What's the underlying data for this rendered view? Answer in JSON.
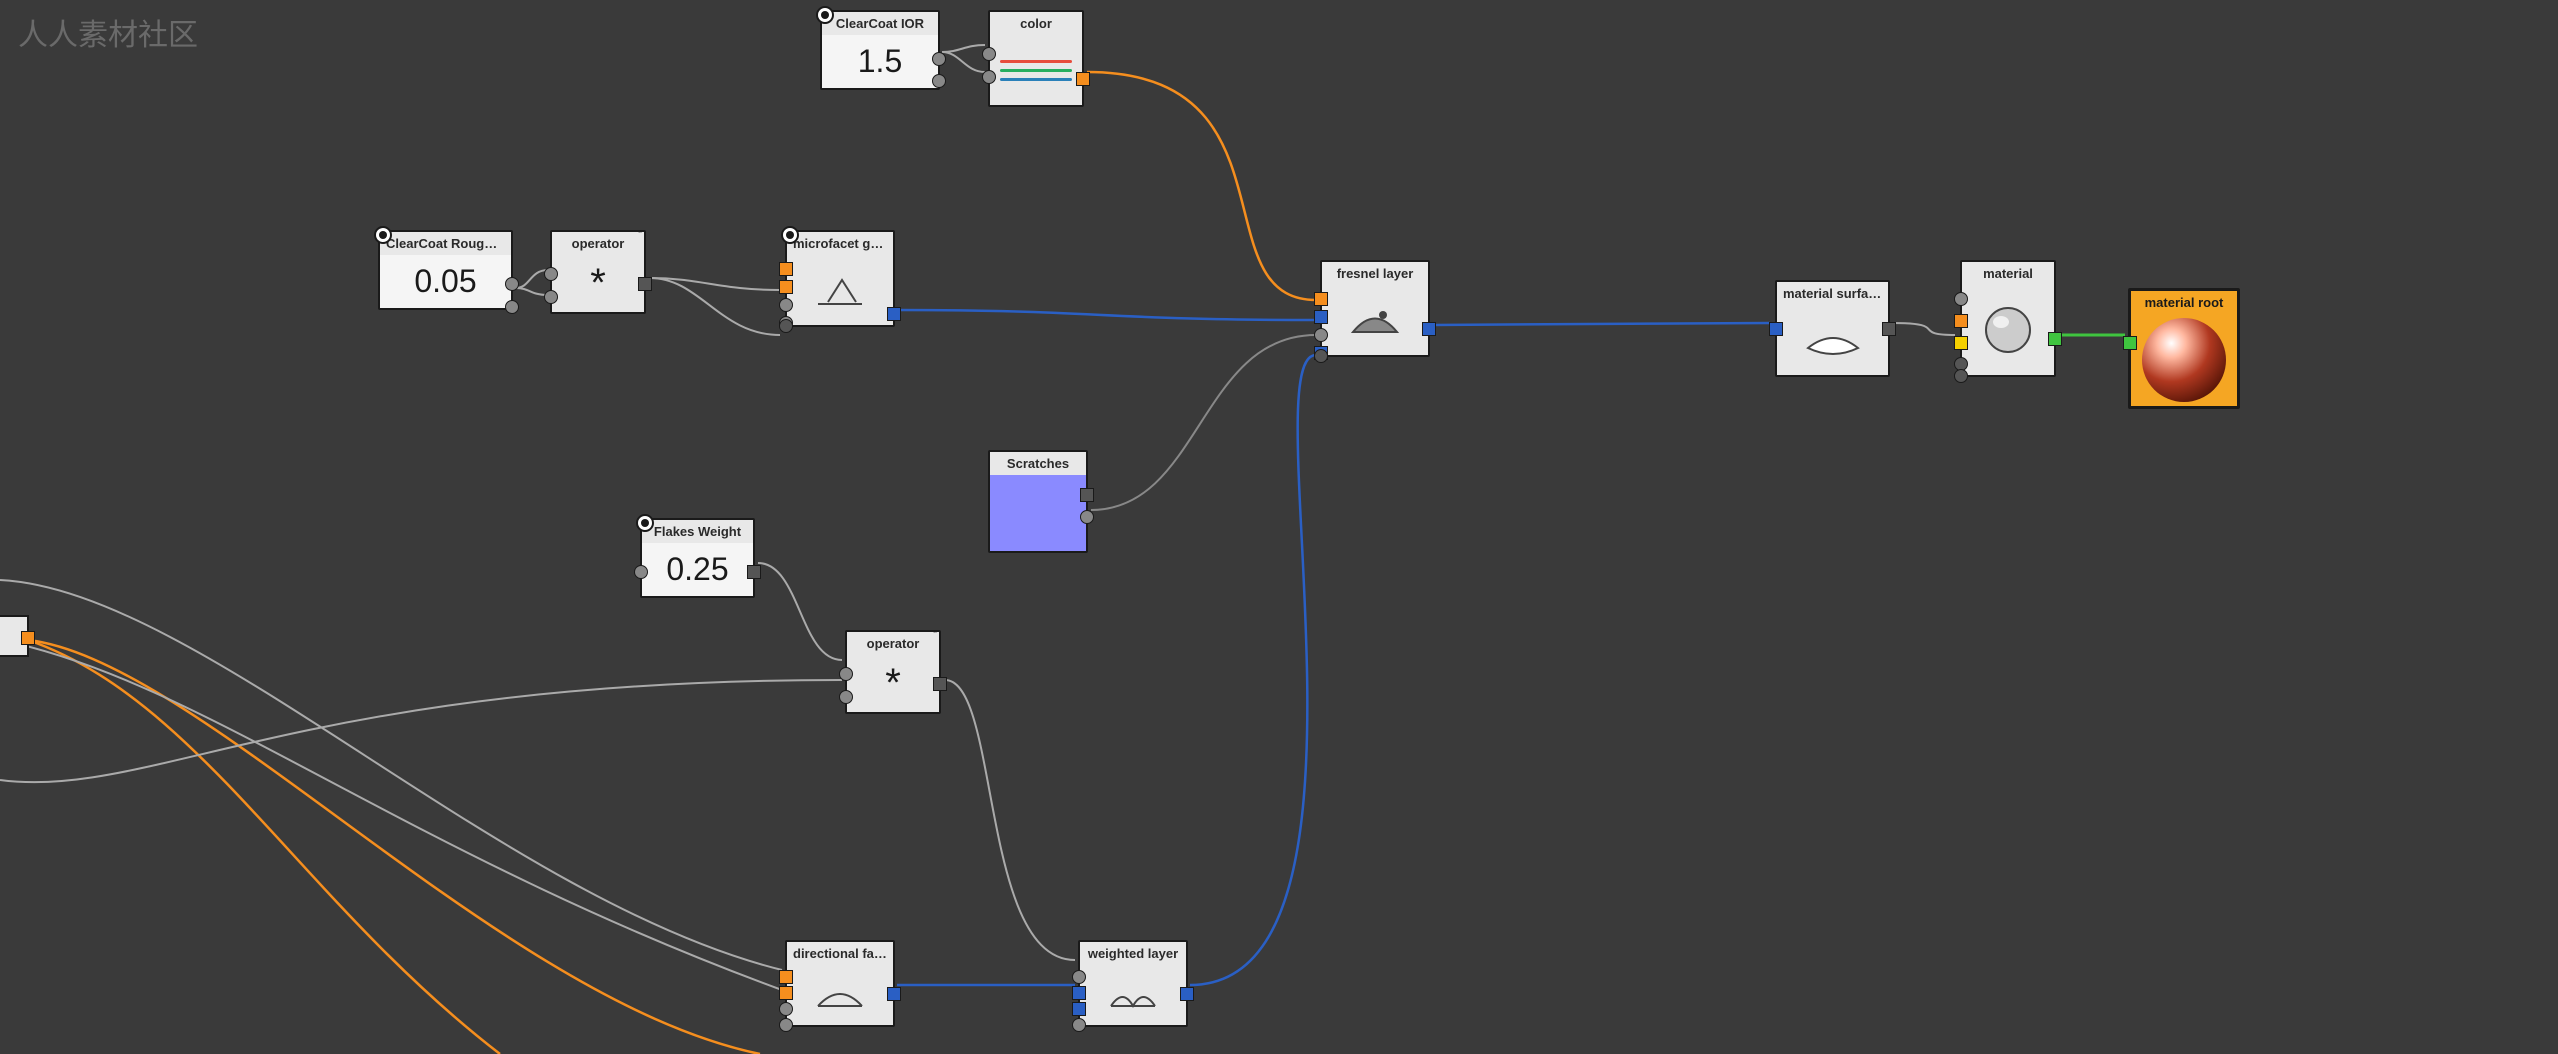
{
  "watermark": "人人素材社区",
  "nodes": {
    "clearcoat_ior": {
      "title": "ClearCoat IOR",
      "value": "1.5"
    },
    "color": {
      "title": "color"
    },
    "clearcoat_roughness": {
      "title": "ClearCoat Roughn...",
      "value": "0.05"
    },
    "operator1": {
      "title": "operator",
      "symbol": "*"
    },
    "microfacet": {
      "title": "microfacet ggx sm..."
    },
    "fresnel_layer": {
      "title": "fresnel layer"
    },
    "material_surface": {
      "title": "material surface"
    },
    "material": {
      "title": "material"
    },
    "material_root": {
      "title": "material root"
    },
    "scratches": {
      "title": "Scratches"
    },
    "flakes_weight": {
      "title": "Flakes Weight",
      "value": "0.25"
    },
    "operator2": {
      "title": "operator",
      "symbol": "*"
    },
    "directional_factor": {
      "title": "directional factor"
    },
    "weighted_layer": {
      "title": "weighted layer"
    }
  }
}
